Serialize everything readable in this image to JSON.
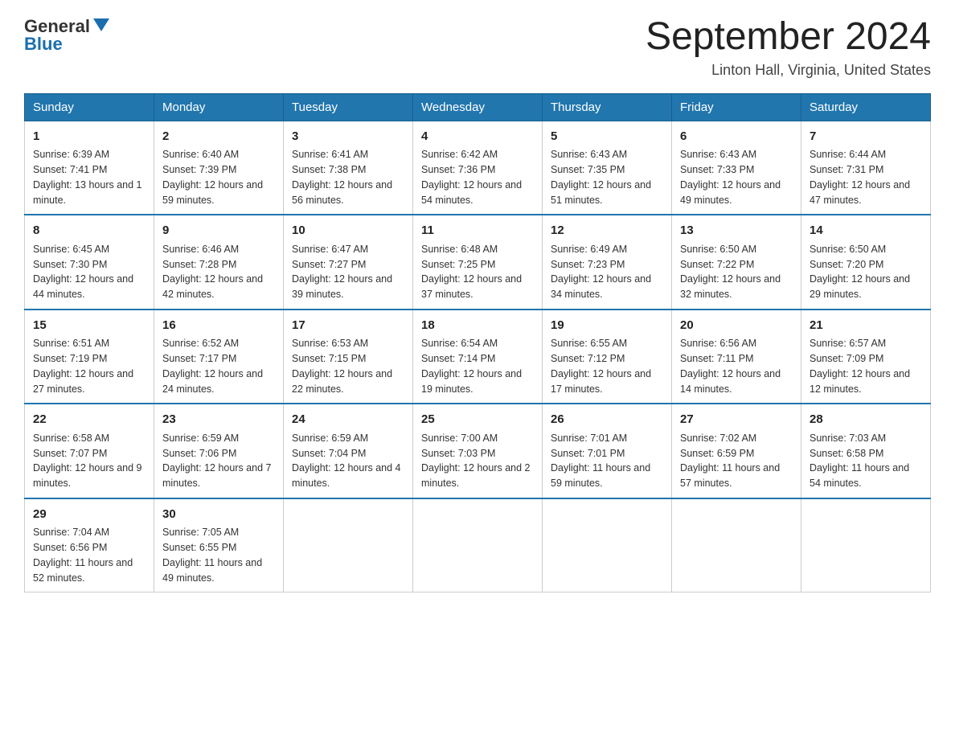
{
  "header": {
    "logo_general": "General",
    "logo_blue": "Blue",
    "title": "September 2024",
    "location": "Linton Hall, Virginia, United States"
  },
  "weekdays": [
    "Sunday",
    "Monday",
    "Tuesday",
    "Wednesday",
    "Thursday",
    "Friday",
    "Saturday"
  ],
  "weeks": [
    [
      {
        "day": "1",
        "sunrise": "6:39 AM",
        "sunset": "7:41 PM",
        "daylight": "13 hours and 1 minute."
      },
      {
        "day": "2",
        "sunrise": "6:40 AM",
        "sunset": "7:39 PM",
        "daylight": "12 hours and 59 minutes."
      },
      {
        "day": "3",
        "sunrise": "6:41 AM",
        "sunset": "7:38 PM",
        "daylight": "12 hours and 56 minutes."
      },
      {
        "day": "4",
        "sunrise": "6:42 AM",
        "sunset": "7:36 PM",
        "daylight": "12 hours and 54 minutes."
      },
      {
        "day": "5",
        "sunrise": "6:43 AM",
        "sunset": "7:35 PM",
        "daylight": "12 hours and 51 minutes."
      },
      {
        "day": "6",
        "sunrise": "6:43 AM",
        "sunset": "7:33 PM",
        "daylight": "12 hours and 49 minutes."
      },
      {
        "day": "7",
        "sunrise": "6:44 AM",
        "sunset": "7:31 PM",
        "daylight": "12 hours and 47 minutes."
      }
    ],
    [
      {
        "day": "8",
        "sunrise": "6:45 AM",
        "sunset": "7:30 PM",
        "daylight": "12 hours and 44 minutes."
      },
      {
        "day": "9",
        "sunrise": "6:46 AM",
        "sunset": "7:28 PM",
        "daylight": "12 hours and 42 minutes."
      },
      {
        "day": "10",
        "sunrise": "6:47 AM",
        "sunset": "7:27 PM",
        "daylight": "12 hours and 39 minutes."
      },
      {
        "day": "11",
        "sunrise": "6:48 AM",
        "sunset": "7:25 PM",
        "daylight": "12 hours and 37 minutes."
      },
      {
        "day": "12",
        "sunrise": "6:49 AM",
        "sunset": "7:23 PM",
        "daylight": "12 hours and 34 minutes."
      },
      {
        "day": "13",
        "sunrise": "6:50 AM",
        "sunset": "7:22 PM",
        "daylight": "12 hours and 32 minutes."
      },
      {
        "day": "14",
        "sunrise": "6:50 AM",
        "sunset": "7:20 PM",
        "daylight": "12 hours and 29 minutes."
      }
    ],
    [
      {
        "day": "15",
        "sunrise": "6:51 AM",
        "sunset": "7:19 PM",
        "daylight": "12 hours and 27 minutes."
      },
      {
        "day": "16",
        "sunrise": "6:52 AM",
        "sunset": "7:17 PM",
        "daylight": "12 hours and 24 minutes."
      },
      {
        "day": "17",
        "sunrise": "6:53 AM",
        "sunset": "7:15 PM",
        "daylight": "12 hours and 22 minutes."
      },
      {
        "day": "18",
        "sunrise": "6:54 AM",
        "sunset": "7:14 PM",
        "daylight": "12 hours and 19 minutes."
      },
      {
        "day": "19",
        "sunrise": "6:55 AM",
        "sunset": "7:12 PM",
        "daylight": "12 hours and 17 minutes."
      },
      {
        "day": "20",
        "sunrise": "6:56 AM",
        "sunset": "7:11 PM",
        "daylight": "12 hours and 14 minutes."
      },
      {
        "day": "21",
        "sunrise": "6:57 AM",
        "sunset": "7:09 PM",
        "daylight": "12 hours and 12 minutes."
      }
    ],
    [
      {
        "day": "22",
        "sunrise": "6:58 AM",
        "sunset": "7:07 PM",
        "daylight": "12 hours and 9 minutes."
      },
      {
        "day": "23",
        "sunrise": "6:59 AM",
        "sunset": "7:06 PM",
        "daylight": "12 hours and 7 minutes."
      },
      {
        "day": "24",
        "sunrise": "6:59 AM",
        "sunset": "7:04 PM",
        "daylight": "12 hours and 4 minutes."
      },
      {
        "day": "25",
        "sunrise": "7:00 AM",
        "sunset": "7:03 PM",
        "daylight": "12 hours and 2 minutes."
      },
      {
        "day": "26",
        "sunrise": "7:01 AM",
        "sunset": "7:01 PM",
        "daylight": "11 hours and 59 minutes."
      },
      {
        "day": "27",
        "sunrise": "7:02 AM",
        "sunset": "6:59 PM",
        "daylight": "11 hours and 57 minutes."
      },
      {
        "day": "28",
        "sunrise": "7:03 AM",
        "sunset": "6:58 PM",
        "daylight": "11 hours and 54 minutes."
      }
    ],
    [
      {
        "day": "29",
        "sunrise": "7:04 AM",
        "sunset": "6:56 PM",
        "daylight": "11 hours and 52 minutes."
      },
      {
        "day": "30",
        "sunrise": "7:05 AM",
        "sunset": "6:55 PM",
        "daylight": "11 hours and 49 minutes."
      },
      null,
      null,
      null,
      null,
      null
    ]
  ],
  "labels": {
    "sunrise": "Sunrise:",
    "sunset": "Sunset:",
    "daylight": "Daylight:"
  }
}
